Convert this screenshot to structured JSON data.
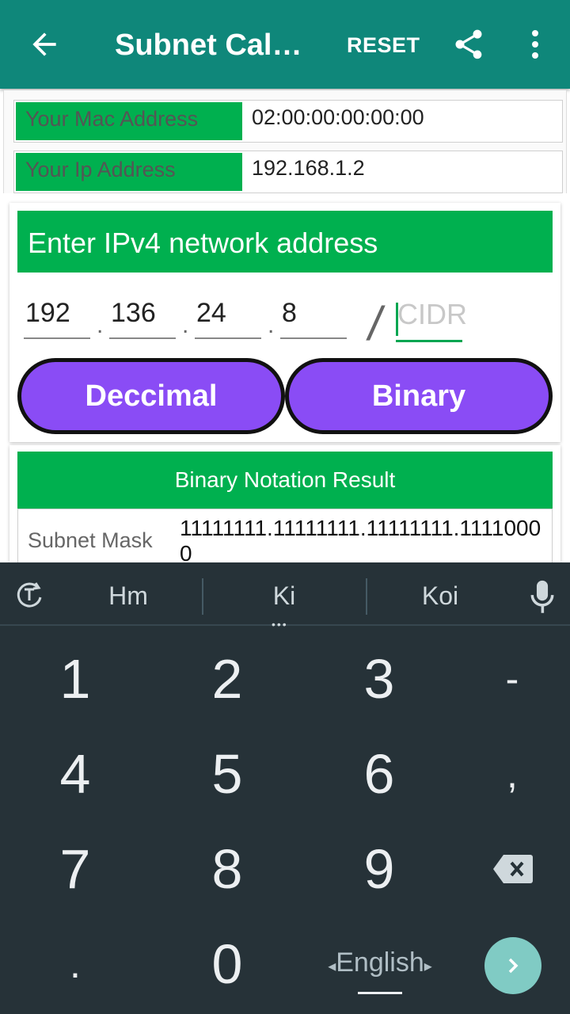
{
  "appbar": {
    "title": "Subnet Calc...",
    "reset_label": "RESET",
    "color": "#0f877a"
  },
  "info": {
    "mac_label": "Your Mac Address",
    "mac_value": "02:00:00:00:00:00",
    "ip_label": "Your Ip Address",
    "ip_value": "192.168.1.2"
  },
  "network": {
    "header": "Enter IPv4 network address",
    "octets": [
      "192",
      "136",
      "24",
      "8"
    ],
    "separator": ".",
    "slash": "/",
    "cidr_placeholder": "CIDR",
    "decimal_button": "Deccimal",
    "binary_button": "Binary"
  },
  "result": {
    "header": "Binary Notation Result",
    "subnet_mask_label": "Subnet Mask",
    "subnet_mask_value": "11111111.11111111.11111111.11110000"
  },
  "keyboard": {
    "suggestions": [
      "Hm",
      "Ki",
      "Koi"
    ],
    "keys": [
      "1",
      "2",
      "3",
      "-",
      "4",
      "5",
      "6",
      ",",
      "7",
      "8",
      "9",
      ".",
      "0"
    ],
    "language": "English",
    "lang_left": "◂",
    "lang_right": "▸"
  },
  "colors": {
    "green": "#00b04f",
    "purple": "#8a4cf5",
    "keyboard_bg": "#263238"
  }
}
